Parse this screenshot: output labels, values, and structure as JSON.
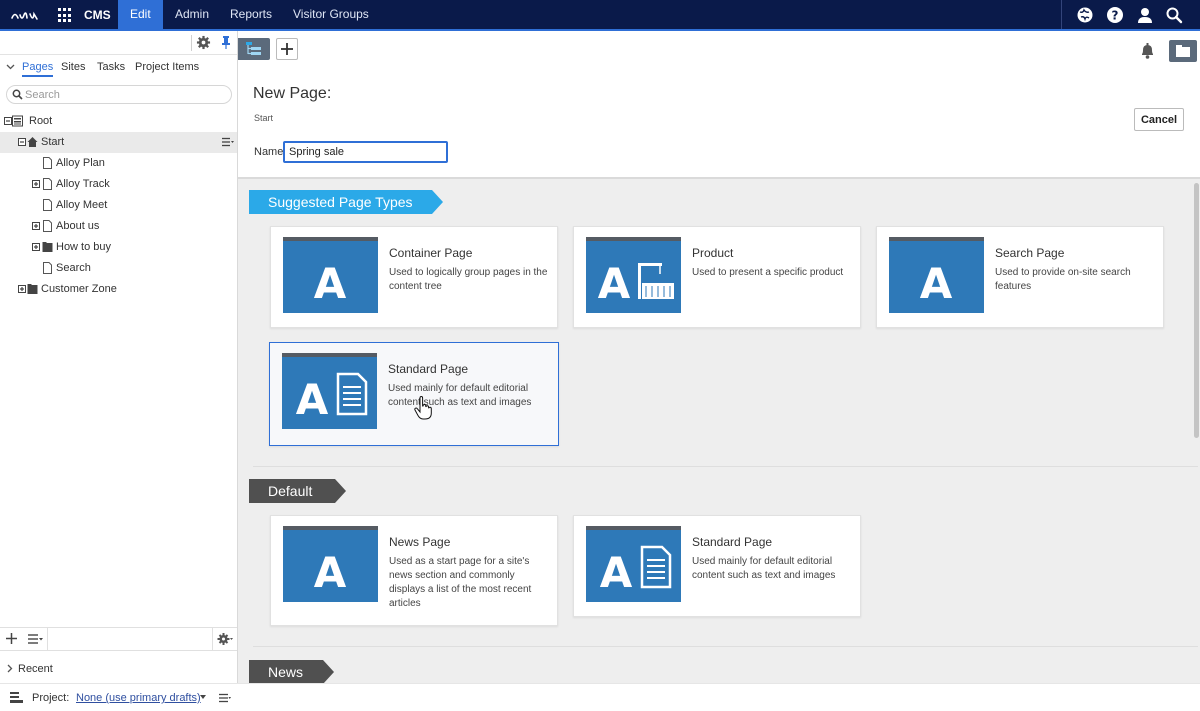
{
  "topnav": {
    "product": "CMS",
    "items": [
      {
        "label": "Edit",
        "active": true
      },
      {
        "label": "Admin",
        "active": false
      },
      {
        "label": "Reports",
        "active": false
      },
      {
        "label": "Visitor Groups",
        "active": false
      }
    ],
    "icons": [
      "epi-logo-icon",
      "app-grid-icon",
      "globe-icon",
      "help-icon",
      "user-icon",
      "search-icon"
    ]
  },
  "leftpane": {
    "tabs": [
      "Pages",
      "Sites",
      "Tasks",
      "Project Items"
    ],
    "active_tab": "Pages",
    "search": {
      "placeholder": "Search",
      "value": ""
    },
    "tree": [
      {
        "label": "Root",
        "level": 0,
        "icon": "root-icon",
        "expander": "minus"
      },
      {
        "label": "Start",
        "level": 1,
        "icon": "home-icon",
        "expander": "minus",
        "selected": true
      },
      {
        "label": "Alloy Plan",
        "level": 2,
        "icon": "page-icon",
        "expander": "none"
      },
      {
        "label": "Alloy Track",
        "level": 2,
        "icon": "page-icon",
        "expander": "plus"
      },
      {
        "label": "Alloy Meet",
        "level": 2,
        "icon": "page-icon",
        "expander": "none"
      },
      {
        "label": "About us",
        "level": 2,
        "icon": "page-icon",
        "expander": "plus"
      },
      {
        "label": "How to buy",
        "level": 2,
        "icon": "folder-icon",
        "expander": "plus"
      },
      {
        "label": "Search",
        "level": 2,
        "icon": "page-icon",
        "expander": "none"
      },
      {
        "label": "Customer Zone",
        "level": 1,
        "icon": "folder-icon",
        "expander": "plus"
      }
    ],
    "recent_label": "Recent"
  },
  "footer": {
    "project_label": "Project:",
    "project_value": "None (use primary drafts)"
  },
  "main": {
    "title": "New Page:",
    "breadcrumb": "Start",
    "cancel_label": "Cancel",
    "name_label": "Name",
    "name_value": "Spring sale"
  },
  "sections": [
    {
      "label": "Suggested Page Types",
      "style": "blue",
      "cards": [
        {
          "title": "Container Page",
          "desc": "Used to logically group pages in the content tree",
          "thumb": "letter",
          "selected": false
        },
        {
          "title": "Product",
          "desc": "Used to present a specific product",
          "thumb": "product",
          "selected": false
        },
        {
          "title": "Search Page",
          "desc": "Used to provide on-site search features",
          "thumb": "letter",
          "selected": false
        },
        {
          "title": "Standard Page",
          "desc": "Used mainly for default editorial content such as text and images",
          "thumb": "document",
          "selected": true
        }
      ]
    },
    {
      "label": "Default",
      "style": "gray",
      "cards": [
        {
          "title": "News Page",
          "desc": "Used as a start page for a site's news section and commonly displays a list of the most recent articles",
          "thumb": "letter",
          "selected": false
        },
        {
          "title": "Standard Page",
          "desc": "Used mainly for default editorial content such as text and images",
          "thumb": "document",
          "selected": false
        }
      ]
    },
    {
      "label": "News",
      "style": "gray",
      "cards": []
    }
  ],
  "colors": {
    "nav_bg": "#0a1a4a",
    "accent": "#2f6fd6",
    "thumb_blue": "#2e79b8",
    "ribbon_blue": "#2ba9e8",
    "ribbon_gray": "#505050"
  }
}
